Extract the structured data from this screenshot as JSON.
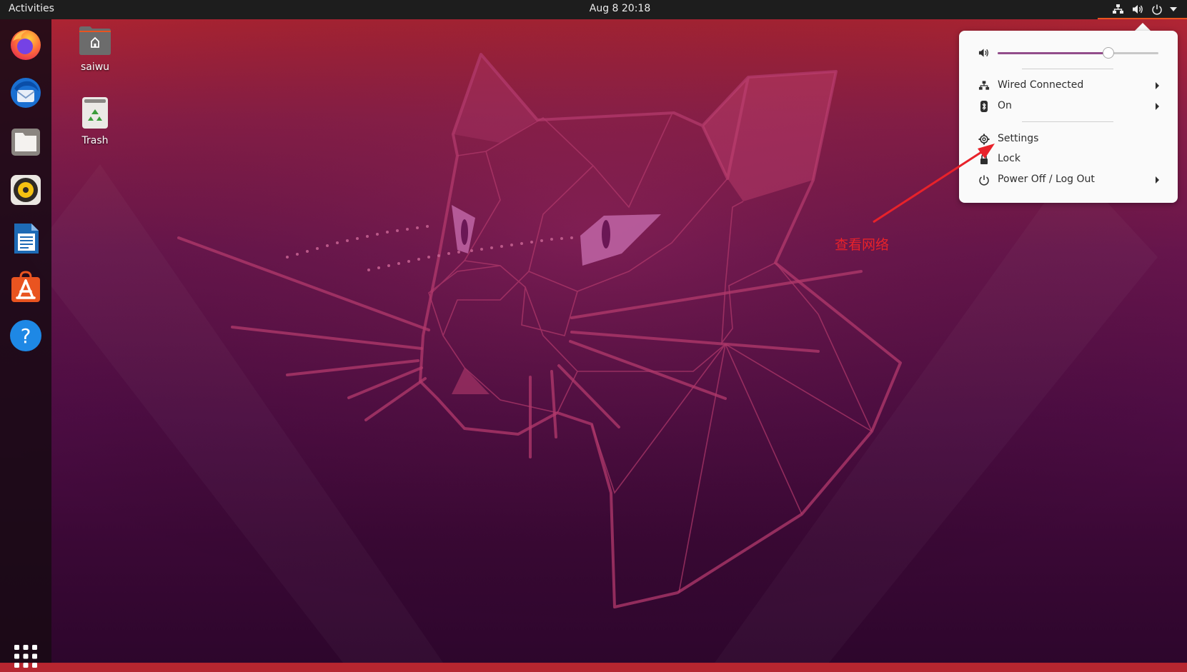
{
  "topbar": {
    "activities_label": "Activities",
    "clock": "Aug 8  20:18",
    "tray_icons": [
      "network-wired-icon",
      "volume-icon",
      "power-icon",
      "dropdown-arrow-icon"
    ]
  },
  "dock": {
    "items": [
      {
        "name": "Firefox",
        "icon": "firefox-icon"
      },
      {
        "name": "Thunderbird",
        "icon": "thunderbird-icon"
      },
      {
        "name": "Files",
        "icon": "files-icon"
      },
      {
        "name": "Rhythmbox",
        "icon": "rhythmbox-icon"
      },
      {
        "name": "LibreOffice Writer",
        "icon": "writer-icon"
      },
      {
        "name": "Ubuntu Software",
        "icon": "software-icon"
      },
      {
        "name": "Help",
        "icon": "help-icon"
      }
    ],
    "show_apps_icon": "apps-grid-icon"
  },
  "desktop": {
    "icons": [
      {
        "label": "saiwu",
        "icon": "home-folder-icon"
      },
      {
        "label": "Trash",
        "icon": "trash-icon"
      }
    ]
  },
  "system_menu": {
    "volume_percent": 69,
    "items": [
      {
        "label": "Wired Connected",
        "icon": "network-wired-icon",
        "submenu": true
      },
      {
        "label": "On",
        "icon": "bluetooth-icon",
        "submenu": true
      },
      {
        "label": "Settings",
        "icon": "settings-gear-icon",
        "submenu": false
      },
      {
        "label": "Lock",
        "icon": "lock-icon",
        "submenu": false
      },
      {
        "label": "Power Off / Log Out",
        "icon": "power-icon",
        "submenu": true
      }
    ]
  },
  "annotation": {
    "text": "查看网络",
    "color": "#e8222a"
  },
  "colors": {
    "accent": "#e95420",
    "slider_fill": "#924d8b",
    "topbar_bg": "#1d1d1d",
    "menu_bg": "#fafafa"
  }
}
